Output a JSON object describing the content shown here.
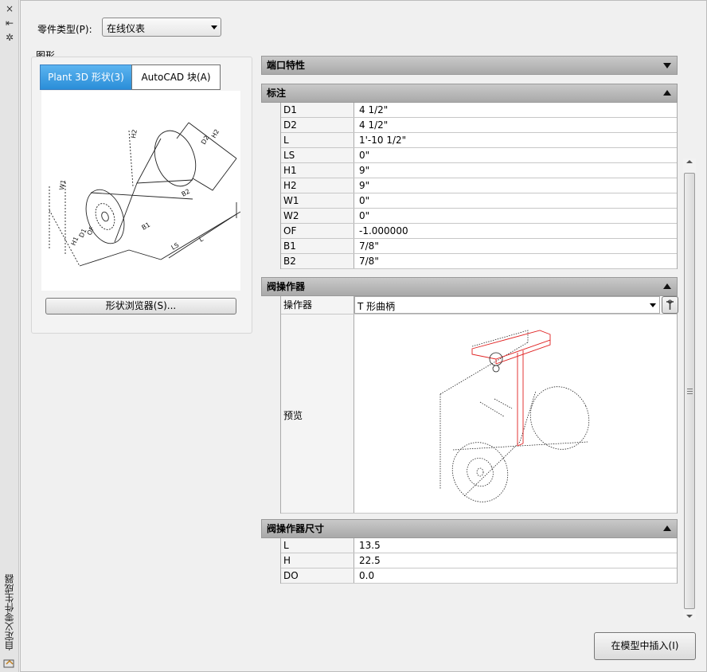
{
  "window": {
    "vertical_title": "自定义零件生成器",
    "close_icon": "×",
    "autohide_icon": "⇤",
    "properties_icon": "✲"
  },
  "part_type": {
    "label": "零件类型(P):",
    "value": "在线仪表"
  },
  "graphics": {
    "group_label": "图形",
    "tabs": [
      {
        "label": "Plant 3D 形状(3)",
        "active": true
      },
      {
        "label": "AutoCAD 块(A)",
        "active": false
      }
    ],
    "shape_browser_button": "形状浏览器(S)...",
    "dimension_labels": [
      "H2",
      "D2",
      "B2",
      "W1",
      "H2",
      "B1",
      "L",
      "LS",
      "H1",
      "D1",
      "OF"
    ]
  },
  "sections": {
    "port_properties": {
      "title": "端口特性",
      "expanded": false
    },
    "dimensions": {
      "title": "标注",
      "expanded": true,
      "rows": [
        {
          "key": "D1",
          "value": "4 1/2\""
        },
        {
          "key": "D2",
          "value": "4 1/2\""
        },
        {
          "key": "L",
          "value": "1'-10 1/2\""
        },
        {
          "key": "LS",
          "value": "0\""
        },
        {
          "key": "H1",
          "value": "9\""
        },
        {
          "key": "H2",
          "value": "9\""
        },
        {
          "key": "W1",
          "value": "0\""
        },
        {
          "key": "W2",
          "value": "0\""
        },
        {
          "key": "OF",
          "value": "-1.000000"
        },
        {
          "key": "B1",
          "value": "7/8\""
        },
        {
          "key": "B2",
          "value": "7/8\""
        }
      ]
    },
    "valve_operator": {
      "title": "阀操作器",
      "expanded": true,
      "operator_label": "操作器",
      "operator_value": "T 形曲柄",
      "preview_label": "预览"
    },
    "operator_size": {
      "title": "阀操作器尺寸",
      "expanded": true,
      "rows": [
        {
          "key": "L",
          "value": "13.5"
        },
        {
          "key": "H",
          "value": "22.5"
        },
        {
          "key": "DO",
          "value": "0.0"
        }
      ]
    }
  },
  "insert_button": "在模型中插入(I)",
  "colors": {
    "accent_tab": "#2a8ed8",
    "section_header": "#b5b5b5",
    "operator_red": "#e02020"
  }
}
